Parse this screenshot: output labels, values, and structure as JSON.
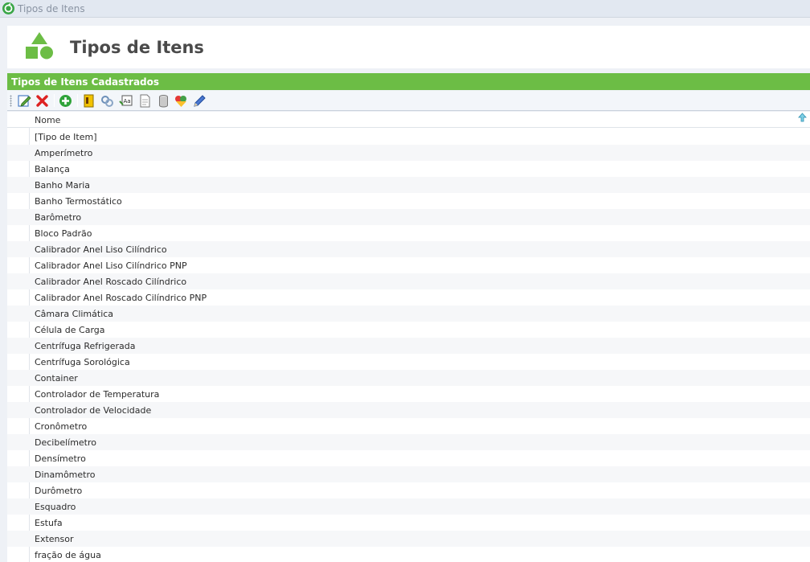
{
  "window": {
    "title": "Tipos de Itens"
  },
  "header": {
    "title": "Tipos de Itens"
  },
  "section": {
    "title": "Tipos de Itens Cadastrados"
  },
  "toolbar": {
    "buttons": [
      "edit-icon",
      "delete-icon",
      "add-icon",
      "filter-icon",
      "link-icon",
      "font-icon",
      "document-icon",
      "database-icon",
      "colors-icon",
      "pencil-icon"
    ]
  },
  "grid": {
    "column": "Nome",
    "rows": [
      "[Tipo de Item]",
      "Amperímetro",
      "Balança",
      "Banho Maria",
      "Banho Termostático",
      "Barômetro",
      "Bloco Padrão",
      "Calibrador Anel Liso Cilíndrico",
      "Calibrador Anel Liso Cilíndrico PNP",
      "Calibrador Anel Roscado Cilíndrico",
      "Calibrador Anel Roscado Cilíndrico PNP",
      "Câmara Climática",
      "Célula de Carga",
      "Centrífuga Refrigerada",
      "Centrífuga Sorológica",
      "Container",
      "Controlador de Temperatura",
      "Controlador de Velocidade",
      "Cronômetro",
      "Decibelímetro",
      "Densímetro",
      "Dinamômetro",
      "Durômetro",
      "Esquadro",
      "Estufa",
      "Extensor",
      "fração de água"
    ]
  },
  "colors": {
    "accent": "#6cbd45",
    "titlebar": "#e2e8f1"
  }
}
